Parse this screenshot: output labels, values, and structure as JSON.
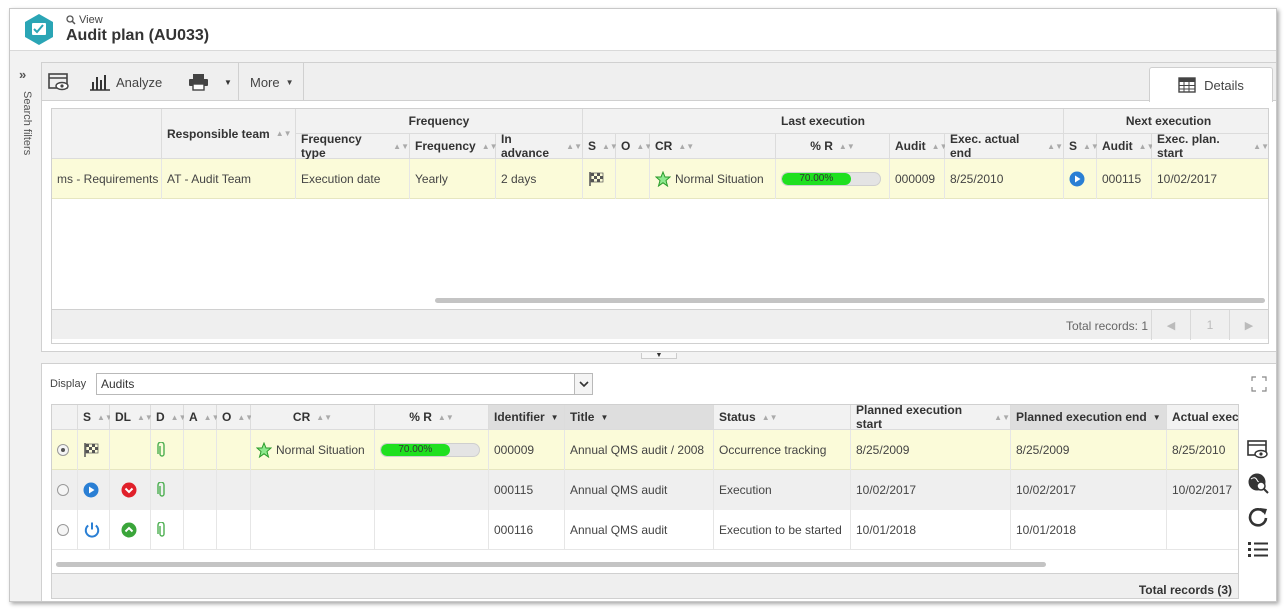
{
  "header": {
    "view_label": "View",
    "title": "Audit plan (AU033)"
  },
  "left_rail": {
    "label": "Search filters"
  },
  "toolbar": {
    "analyze_label": "Analyze",
    "more_label": "More",
    "details_tab_label": "Details"
  },
  "upper_grid": {
    "group_headers": {
      "frequency": "Frequency",
      "last_execution": "Last execution",
      "next_execution": "Next execution"
    },
    "columns": {
      "responsible_team": "Responsible team",
      "frequency_type": "Frequency type",
      "frequency": "Frequency",
      "in_advance": "In advance",
      "s": "S",
      "o": "O",
      "cr": "CR",
      "pct_r": "% R",
      "audit": "Audit",
      "exec_actual_end": "Exec. actual end",
      "next_s": "S",
      "next_audit": "Audit",
      "exec_plan_start": "Exec. plan. start"
    },
    "row": {
      "requirements": "ms - Requirements",
      "responsible_team": "AT - Audit Team",
      "frequency_type": "Execution date",
      "frequency": "Yearly",
      "in_advance": "2 days",
      "cr": "Normal Situation",
      "pct_r": "70.00%",
      "pct_r_value": 70,
      "audit": "000009",
      "exec_actual_end": "8/25/2010",
      "next_audit": "000115",
      "exec_plan_start": "10/02/2017"
    },
    "footer": {
      "total_records": "Total records: 1",
      "page": "1"
    }
  },
  "lower": {
    "display_label": "Display",
    "display_value": "Audits",
    "columns": {
      "s": "S",
      "dl": "DL",
      "d": "D",
      "a": "A",
      "o": "O",
      "cr": "CR",
      "pct_r": "% R",
      "identifier": "Identifier",
      "title": "Title",
      "status": "Status",
      "planned_start": "Planned execution start",
      "planned_end": "Planned execution end",
      "actual_exec": "Actual exec"
    },
    "rows": [
      {
        "cr": "Normal Situation",
        "pct_r": "70.00%",
        "pct_r_value": 70,
        "identifier": "000009",
        "title": "Annual QMS audit / 2008",
        "status": "Occurrence tracking",
        "planned_start": "8/25/2009",
        "planned_end": "8/25/2009",
        "actual_exec": "8/25/2010"
      },
      {
        "cr": "",
        "pct_r": "",
        "identifier": "000115",
        "title": "Annual QMS audit",
        "status": "Execution",
        "planned_start": "10/02/2017",
        "planned_end": "10/02/2017",
        "actual_exec": "10/02/2017"
      },
      {
        "cr": "",
        "pct_r": "",
        "identifier": "000116",
        "title": "Annual QMS audit",
        "status": "Execution to be started",
        "planned_start": "10/01/2018",
        "planned_end": "10/01/2018",
        "actual_exec": ""
      }
    ],
    "total_records": "Total records (3)"
  },
  "colors": {
    "progress_green": "#1fe01f",
    "highlight_row": "#fbfbd9",
    "play_blue": "#2a7fd4",
    "red_badge": "#e0202a",
    "green_badge": "#3aa53a",
    "logo_teal": "#2aa5b5"
  }
}
